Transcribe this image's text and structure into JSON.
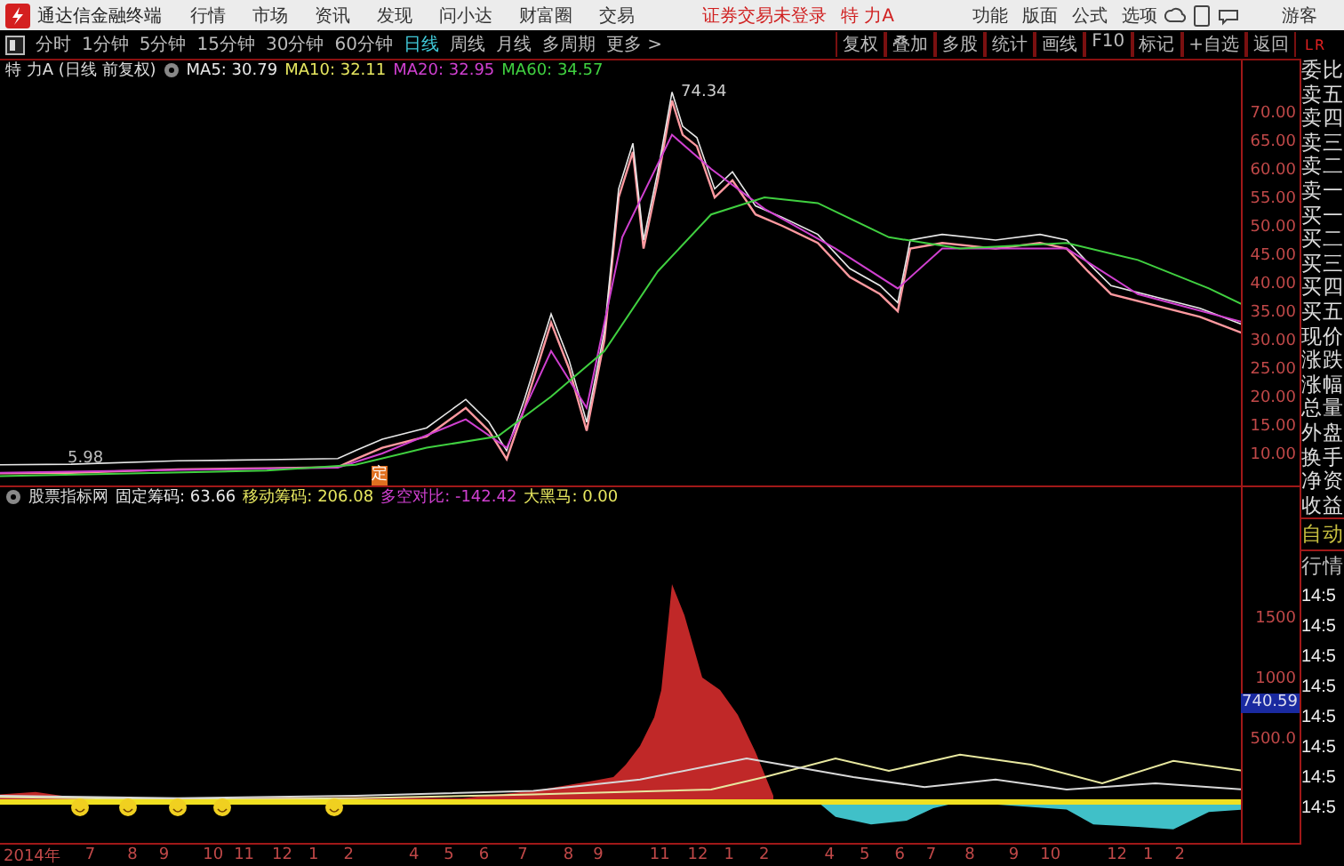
{
  "menu_bar": {
    "app_title": "通达信金融终端",
    "menus": [
      "行情",
      "市场",
      "资讯",
      "发现",
      "问小达",
      "财富圈",
      "交易"
    ],
    "notice": "证券交易未登录",
    "stock": "特 力A",
    "actions": [
      "功能",
      "版面",
      "公式",
      "选项"
    ],
    "user": "游客"
  },
  "period_tabs": [
    {
      "label": "分时",
      "selected": false
    },
    {
      "label": "1分钟",
      "selected": false
    },
    {
      "label": "5分钟",
      "selected": false
    },
    {
      "label": "15分钟",
      "selected": false
    },
    {
      "label": "30分钟",
      "selected": false
    },
    {
      "label": "60分钟",
      "selected": false
    },
    {
      "label": "日线",
      "selected": true
    },
    {
      "label": "周线",
      "selected": false
    },
    {
      "label": "月线",
      "selected": false
    },
    {
      "label": "多周期",
      "selected": false
    },
    {
      "label": "更多 >",
      "selected": false
    }
  ],
  "chart_tools": [
    "复权",
    "叠加",
    "多股",
    "统计",
    "画线",
    "F10",
    "标记",
    "+自选",
    "返回"
  ],
  "panel_header": [
    "L",
    "R"
  ],
  "price_chart": {
    "title": "特 力A (日线 前复权)",
    "indicators": [
      {
        "label": "MA5: 30.79",
        "color": "#e8e8e8"
      },
      {
        "label": "MA10: 32.11",
        "color": "#e8e860"
      },
      {
        "label": "MA20: 32.95",
        "color": "#d040d0"
      },
      {
        "label": "MA60: 34.57",
        "color": "#40d040"
      }
    ],
    "high_label": "74.34",
    "low_label": "5.98",
    "marker": "定",
    "axis_labels": [
      "70.00",
      "65.00",
      "60.00",
      "55.00",
      "50.00",
      "45.00",
      "40.00",
      "35.00",
      "30.00",
      "25.00",
      "20.00",
      "15.00",
      "10.00"
    ]
  },
  "indicator_chart": {
    "title": "股票指标网",
    "values": [
      {
        "label": "固定筹码: 63.66",
        "color": "#e8e8e8"
      },
      {
        "label": "移动筹码: 206.08",
        "color": "#e8e860"
      },
      {
        "label": "多空对比: -142.42",
        "color": "#d040d0"
      },
      {
        "label": "大黑马: 0.00",
        "color": "#e8e860"
      }
    ],
    "axis_labels": [
      "1500",
      "1000",
      "500.0"
    ],
    "current_value": "740.59"
  },
  "time_axis": [
    "2014年",
    "7",
    "8",
    "9",
    "10",
    "11",
    "12",
    "1",
    "2",
    "4",
    "5",
    "6",
    "7",
    "8",
    "9",
    "11",
    "12",
    "1",
    "2",
    "4",
    "5",
    "6",
    "7",
    "8",
    "9",
    "10",
    "12",
    "1",
    "2"
  ],
  "quote_panel": {
    "rows": [
      "委比",
      "卖五",
      "卖四",
      "卖三",
      "卖二",
      "卖一",
      "买一",
      "买二",
      "买三",
      "买四",
      "买五",
      "现价",
      "涨跌",
      "涨幅",
      "总量",
      "外盘",
      "换手",
      "净资",
      "收益"
    ],
    "tabs": [
      "自动",
      "行情"
    ],
    "times": [
      "14:5",
      "14:5",
      "14:5",
      "14:5",
      "14:5",
      "14:5",
      "14:5",
      "14:5"
    ]
  }
}
